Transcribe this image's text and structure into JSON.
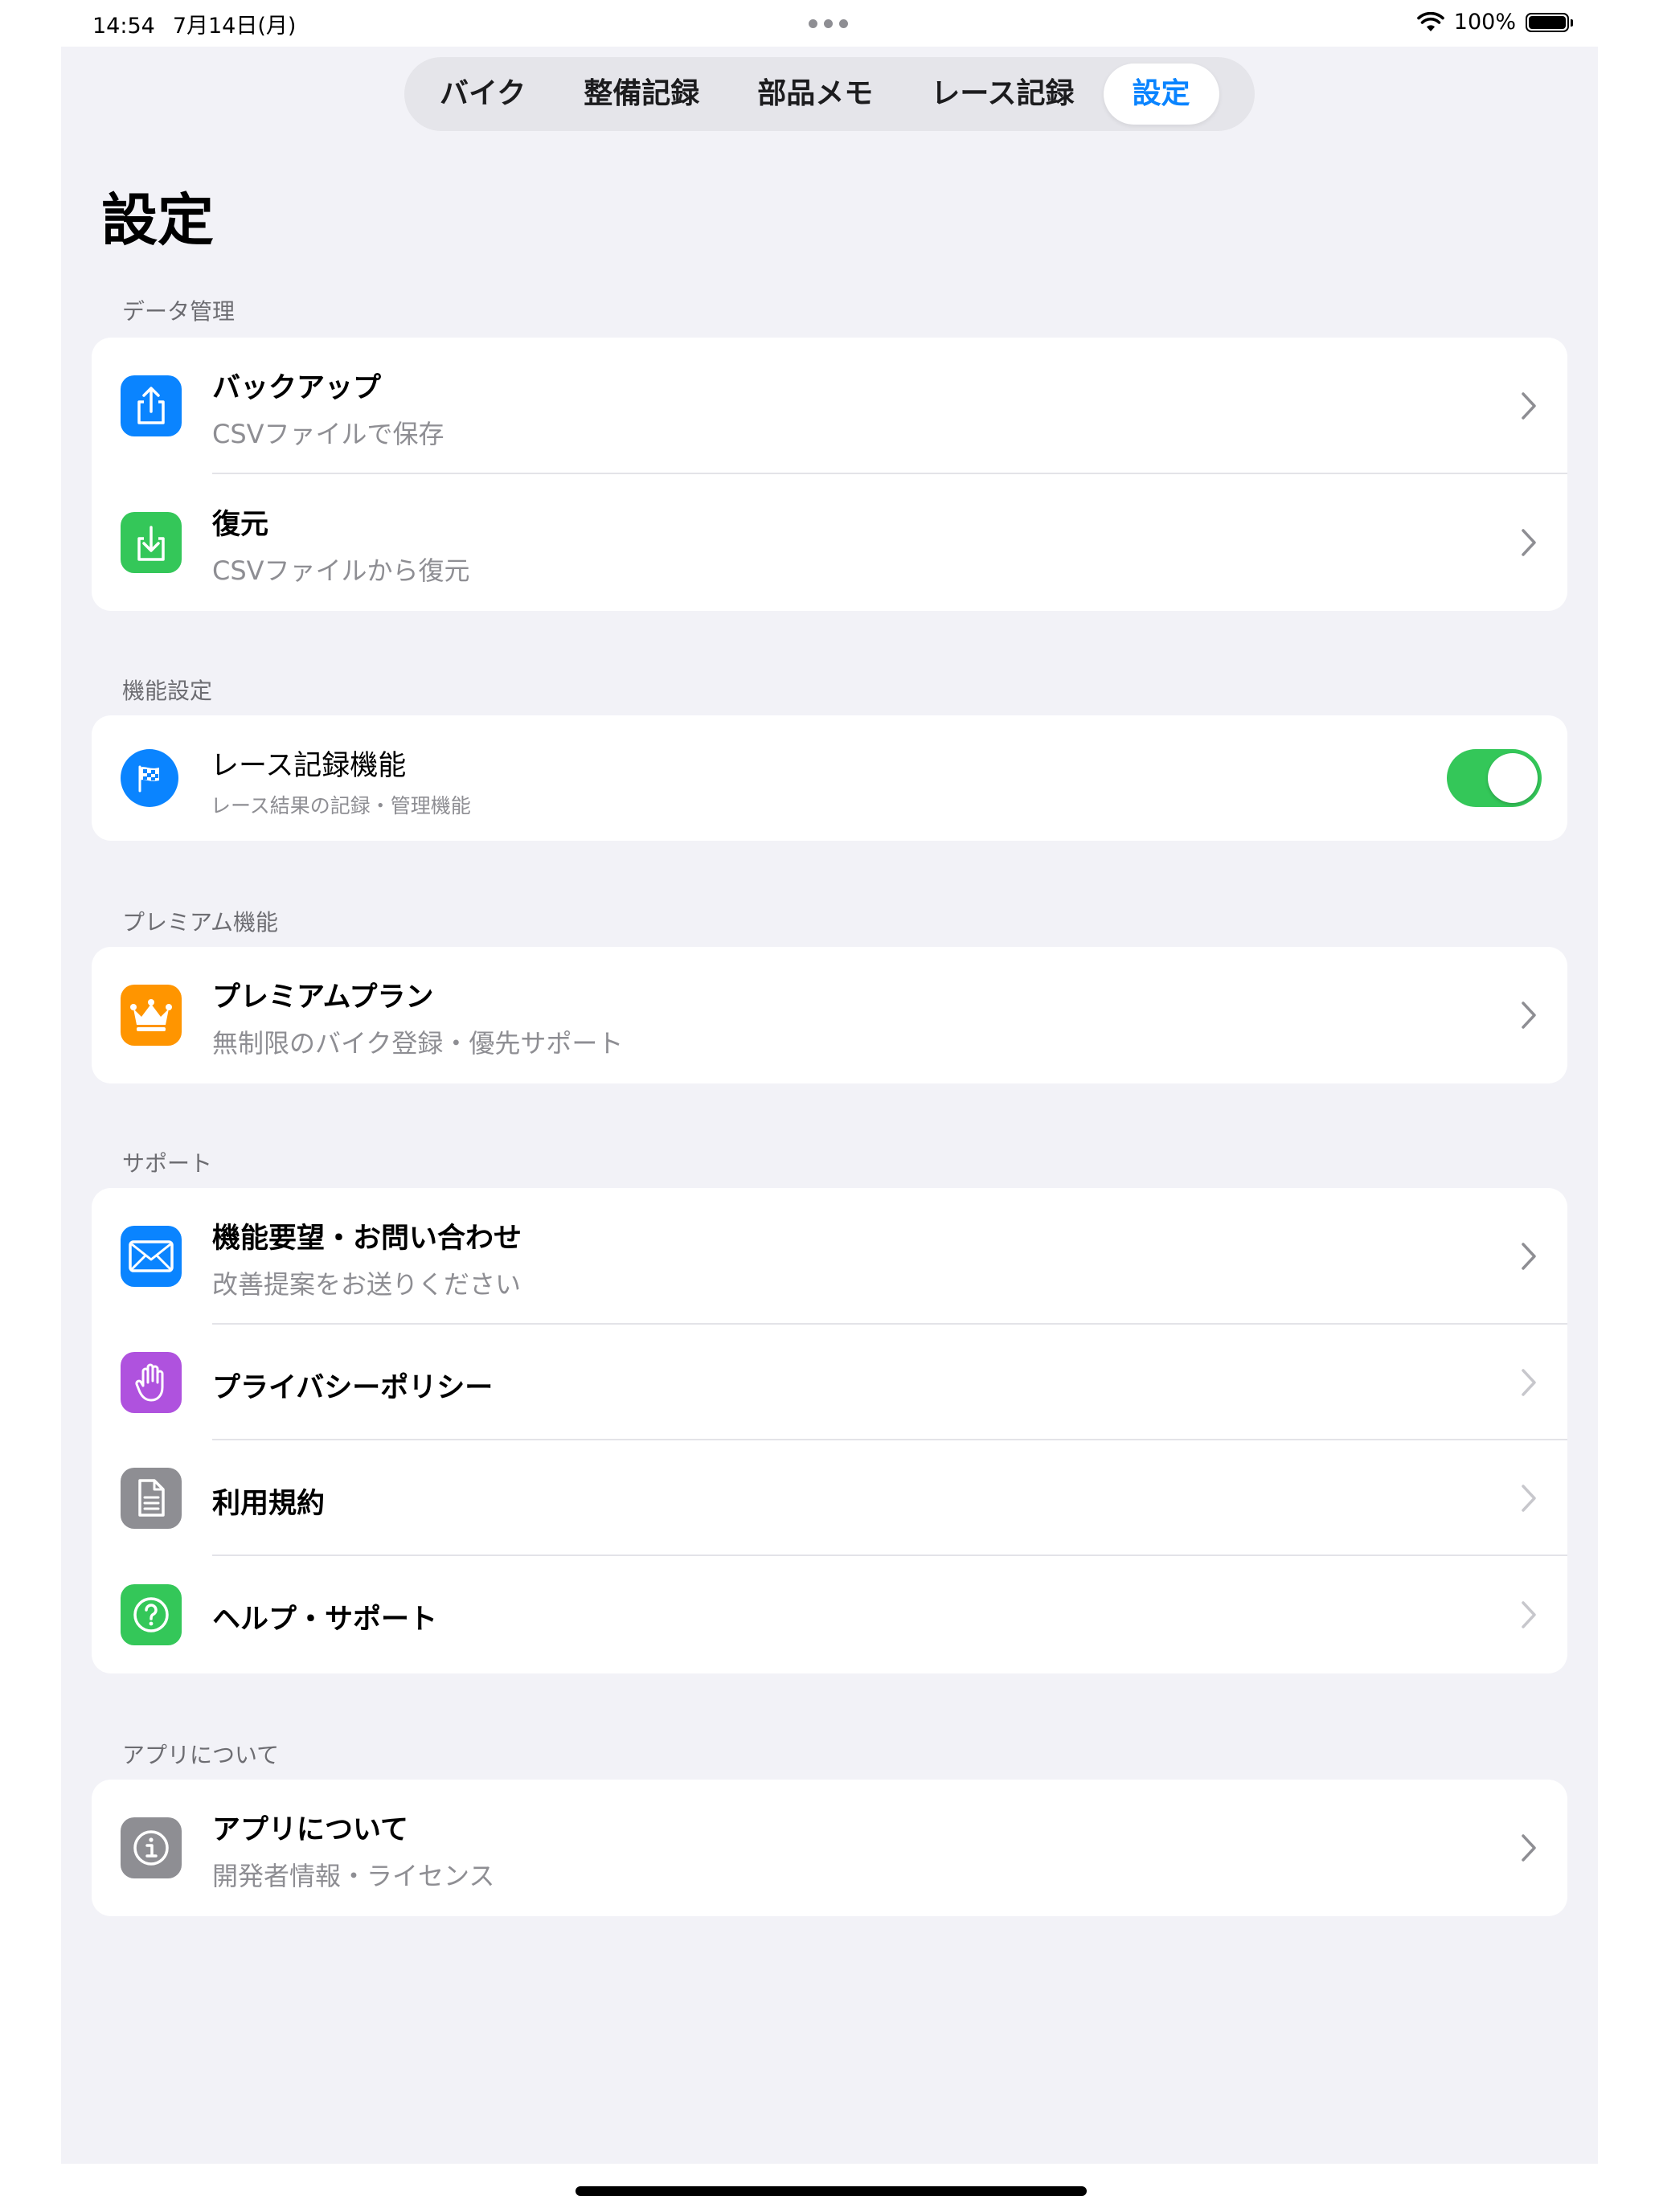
{
  "status_bar": {
    "time": "14:54",
    "date": "7月14日(月)",
    "battery": "100%"
  },
  "tabs": [
    {
      "label": "バイク",
      "active": false
    },
    {
      "label": "整備記録",
      "active": false
    },
    {
      "label": "部品メモ",
      "active": false
    },
    {
      "label": "レース記録",
      "active": false
    },
    {
      "label": "設定",
      "active": true
    }
  ],
  "page_title": "設定",
  "colors": {
    "accent": "#0a84ff",
    "toggle_on": "#34c759",
    "background": "#f2f2f7"
  },
  "sections": {
    "data": {
      "header": "データ管理",
      "backup": {
        "title": "バックアップ",
        "subtitle": "CSVファイルで保存",
        "icon": "share-icon",
        "color": "#0a84ff"
      },
      "restore": {
        "title": "復元",
        "subtitle": "CSVファイルから復元",
        "icon": "download-icon",
        "color": "#34c759"
      }
    },
    "features": {
      "header": "機能設定",
      "race": {
        "title": "レース記録機能",
        "subtitle": "レース結果の記録・管理機能",
        "icon": "checkered-flag-icon",
        "color": "#0a84ff",
        "enabled": true
      }
    },
    "premium": {
      "header": "プレミアム機能",
      "plan": {
        "title": "プレミアムプラン",
        "subtitle": "無制限のバイク登録・優先サポート",
        "icon": "crown-icon",
        "color": "#ff9500"
      }
    },
    "support": {
      "header": "サポート",
      "feedback": {
        "title": "機能要望・お問い合わせ",
        "subtitle": "改善提案をお送りください",
        "icon": "mail-icon",
        "color": "#0a84ff"
      },
      "privacy": {
        "title": "プライバシーポリシー",
        "icon": "hand-icon",
        "color": "#af52de"
      },
      "terms": {
        "title": "利用規約",
        "icon": "document-icon",
        "color": "#8e8e93"
      },
      "help": {
        "title": "ヘルプ・サポート",
        "icon": "question-icon",
        "color": "#34c759"
      }
    },
    "about": {
      "header": "アプリについて",
      "about_app": {
        "title": "アプリについて",
        "subtitle": "開発者情報・ライセンス",
        "icon": "info-icon",
        "color": "#8e8e93"
      }
    }
  }
}
